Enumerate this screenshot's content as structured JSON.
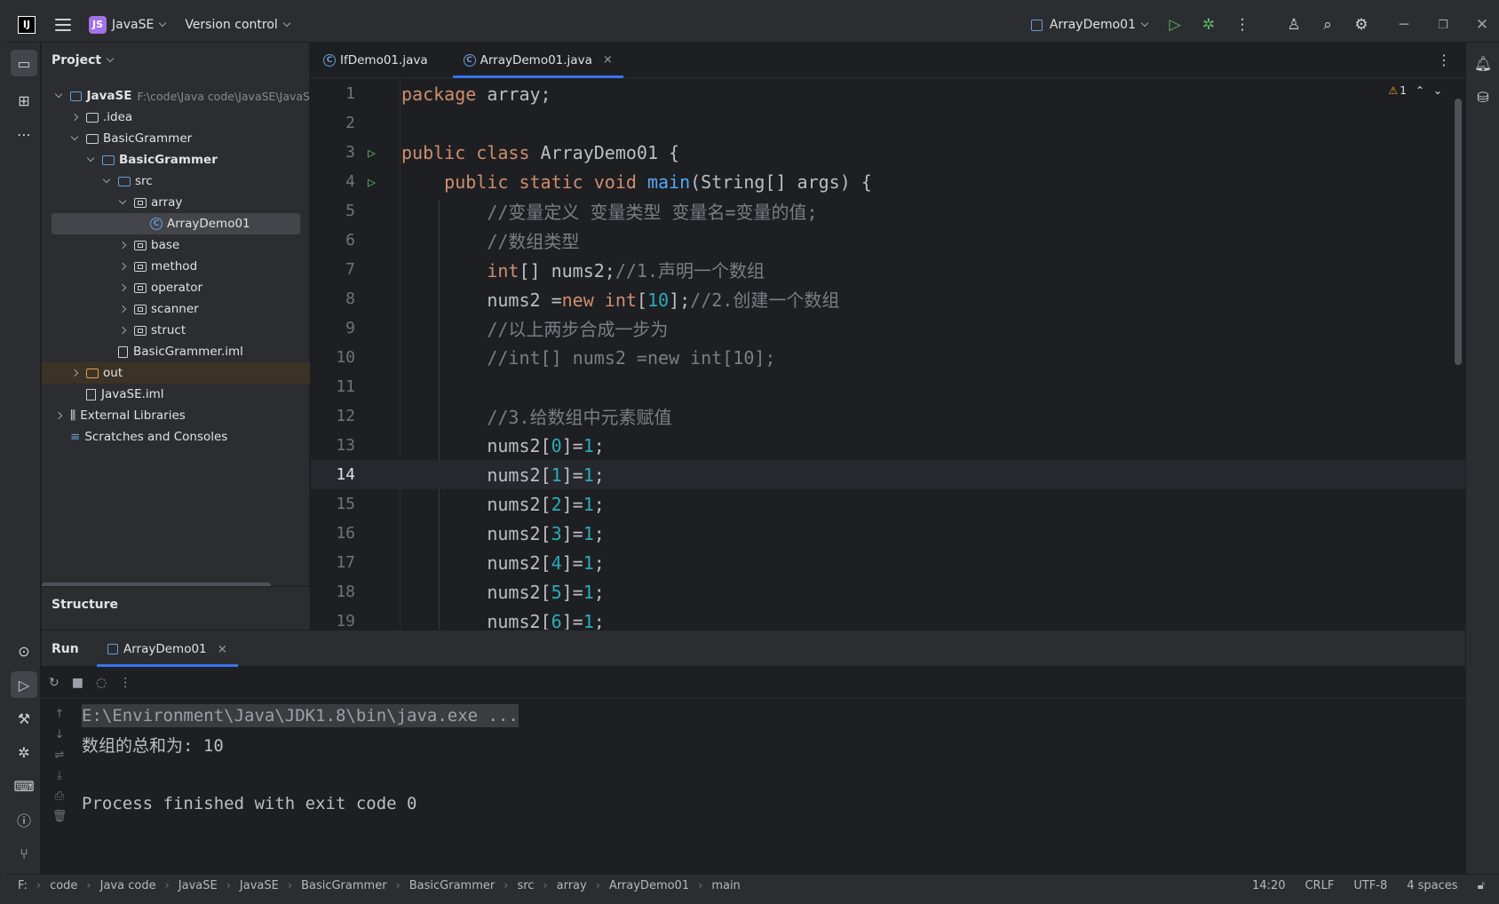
{
  "titlebar": {
    "logo": "IJ",
    "project_badge": "JS",
    "project_name": "JavaSE",
    "vcs": "Version control",
    "run_config": "ArrayDemo01"
  },
  "project_panel": {
    "title": "Project",
    "tree": [
      {
        "label": "JavaSE",
        "path": "F:\\code\\Java code\\JavaSE\\JavaS",
        "depth": 0,
        "kind": "module",
        "open": true,
        "bold": true
      },
      {
        "label": ".idea",
        "depth": 1,
        "kind": "folder",
        "open": false
      },
      {
        "label": "BasicGrammer",
        "depth": 1,
        "kind": "folder",
        "open": true
      },
      {
        "label": "BasicGrammer",
        "depth": 2,
        "kind": "module",
        "open": true,
        "bold": true
      },
      {
        "label": "src",
        "depth": 3,
        "kind": "src",
        "open": true
      },
      {
        "label": "array",
        "depth": 4,
        "kind": "package",
        "open": true
      },
      {
        "label": "ArrayDemo01",
        "depth": 5,
        "kind": "class",
        "selected": true
      },
      {
        "label": "base",
        "depth": 4,
        "kind": "package",
        "open": false
      },
      {
        "label": "method",
        "depth": 4,
        "kind": "package",
        "open": false
      },
      {
        "label": "operator",
        "depth": 4,
        "kind": "package",
        "open": false
      },
      {
        "label": "scanner",
        "depth": 4,
        "kind": "package",
        "open": false
      },
      {
        "label": "struct",
        "depth": 4,
        "kind": "package",
        "open": false
      },
      {
        "label": "BasicGrammer.iml",
        "depth": 3,
        "kind": "file"
      },
      {
        "label": "out",
        "depth": 1,
        "kind": "out",
        "open": false
      },
      {
        "label": "JavaSE.iml",
        "depth": 1,
        "kind": "file"
      },
      {
        "label": "External Libraries",
        "depth": 0,
        "kind": "lib",
        "open": false
      },
      {
        "label": "Scratches and Consoles",
        "depth": 0,
        "kind": "scratch"
      }
    ],
    "structure_title": "Structure"
  },
  "editor": {
    "tabs": [
      {
        "label": "IfDemo01.java",
        "active": false
      },
      {
        "label": "ArrayDemo01.java",
        "active": true
      }
    ],
    "warning_count": "1",
    "lines": [
      {
        "n": "1",
        "run": false,
        "tokens": [
          [
            "kw",
            "package "
          ],
          [
            "p",
            "array;"
          ]
        ]
      },
      {
        "n": "2",
        "run": false,
        "tokens": []
      },
      {
        "n": "3",
        "run": true,
        "tokens": [
          [
            "kw",
            "public class "
          ],
          [
            "p",
            "ArrayDemo01 {"
          ]
        ]
      },
      {
        "n": "4",
        "run": true,
        "tokens": [
          [
            "p",
            "    "
          ],
          [
            "kw",
            "public static void "
          ],
          [
            "fn",
            "main"
          ],
          [
            "p",
            "(String[] args) {"
          ]
        ]
      },
      {
        "n": "5",
        "run": false,
        "tokens": [
          [
            "p",
            "        "
          ],
          [
            "cm",
            "//变量定义 变量类型 变量名=变量的值;"
          ]
        ]
      },
      {
        "n": "6",
        "run": false,
        "tokens": [
          [
            "p",
            "        "
          ],
          [
            "cm",
            "//数组类型"
          ]
        ]
      },
      {
        "n": "7",
        "run": false,
        "tokens": [
          [
            "p",
            "        "
          ],
          [
            "kw",
            "int"
          ],
          [
            "p",
            "[] nums2;"
          ],
          [
            "cm",
            "//1.声明一个数组"
          ]
        ]
      },
      {
        "n": "8",
        "run": false,
        "tokens": [
          [
            "p",
            "        nums2 ="
          ],
          [
            "kw",
            "new int"
          ],
          [
            "p",
            "["
          ],
          [
            "num",
            "10"
          ],
          [
            "p",
            "];"
          ],
          [
            "cm",
            "//2.创建一个数组"
          ]
        ]
      },
      {
        "n": "9",
        "run": false,
        "tokens": [
          [
            "p",
            "        "
          ],
          [
            "cm",
            "//以上两步合成一步为"
          ]
        ]
      },
      {
        "n": "10",
        "run": false,
        "tokens": [
          [
            "p",
            "        "
          ],
          [
            "cm",
            "//int[] nums2 =new int[10];"
          ]
        ]
      },
      {
        "n": "11",
        "run": false,
        "tokens": []
      },
      {
        "n": "12",
        "run": false,
        "tokens": [
          [
            "p",
            "        "
          ],
          [
            "cm",
            "//3.给数组中元素赋值"
          ]
        ]
      },
      {
        "n": "13",
        "run": false,
        "tokens": [
          [
            "p",
            "        nums2["
          ],
          [
            "num",
            "0"
          ],
          [
            "p",
            "]="
          ],
          [
            "num",
            "1"
          ],
          [
            "p",
            ";"
          ]
        ]
      },
      {
        "n": "14",
        "run": false,
        "current": true,
        "tokens": [
          [
            "p",
            "        nums2["
          ],
          [
            "num",
            "1"
          ],
          [
            "p",
            "]="
          ],
          [
            "num",
            "1"
          ],
          [
            "p",
            ";"
          ]
        ]
      },
      {
        "n": "15",
        "run": false,
        "tokens": [
          [
            "p",
            "        nums2["
          ],
          [
            "num",
            "2"
          ],
          [
            "p",
            "]="
          ],
          [
            "num",
            "1"
          ],
          [
            "p",
            ";"
          ]
        ]
      },
      {
        "n": "16",
        "run": false,
        "tokens": [
          [
            "p",
            "        nums2["
          ],
          [
            "num",
            "3"
          ],
          [
            "p",
            "]="
          ],
          [
            "num",
            "1"
          ],
          [
            "p",
            ";"
          ]
        ]
      },
      {
        "n": "17",
        "run": false,
        "tokens": [
          [
            "p",
            "        nums2["
          ],
          [
            "num",
            "4"
          ],
          [
            "p",
            "]="
          ],
          [
            "num",
            "1"
          ],
          [
            "p",
            ";"
          ]
        ]
      },
      {
        "n": "18",
        "run": false,
        "tokens": [
          [
            "p",
            "        nums2["
          ],
          [
            "num",
            "5"
          ],
          [
            "p",
            "]="
          ],
          [
            "num",
            "1"
          ],
          [
            "p",
            ";"
          ]
        ]
      },
      {
        "n": "19",
        "run": false,
        "tokens": [
          [
            "p",
            "        nums2["
          ],
          [
            "num",
            "6"
          ],
          [
            "p",
            "]="
          ],
          [
            "num",
            "1"
          ],
          [
            "p",
            ";"
          ]
        ]
      }
    ]
  },
  "run_panel": {
    "title": "Run",
    "tab": "ArrayDemo01",
    "output": [
      {
        "text": "E:\\Environment\\Java\\JDK1.8\\bin\\java.exe ...",
        "highlight": true
      },
      {
        "text": "数组的总和为: 10",
        "highlight": false
      },
      {
        "text": "",
        "highlight": false
      },
      {
        "text": "Process finished with exit code 0",
        "highlight": false
      }
    ]
  },
  "statusbar": {
    "breadcrumbs": [
      "F:",
      "code",
      "Java code",
      "JavaSE",
      "JavaSE",
      "BasicGrammer",
      "BasicGrammer",
      "src",
      "array",
      "ArrayDemo01",
      "main"
    ],
    "position": "14:20",
    "line_sep": "CRLF",
    "encoding": "UTF-8",
    "indent": "4 spaces"
  }
}
